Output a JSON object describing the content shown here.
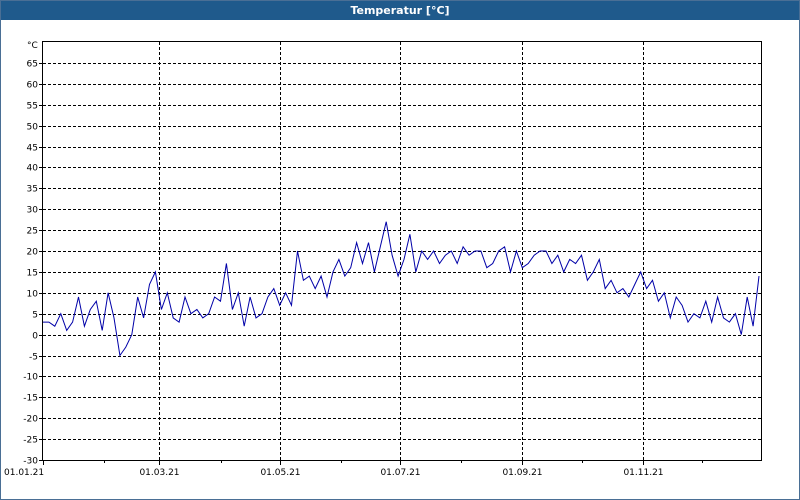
{
  "window": {
    "title": "Temperatur [°C]"
  },
  "colors": {
    "titlebar": "#1f5a8c",
    "series": "#0000a8",
    "grid": "#000000"
  },
  "chart_data": {
    "type": "line",
    "title": "Temperatur [°C]",
    "ylabel": "°C",
    "xlabel": "",
    "ylim": [
      -30,
      70
    ],
    "yticks": [
      -30,
      -25,
      -20,
      -15,
      -10,
      -5,
      0,
      5,
      10,
      15,
      20,
      25,
      30,
      35,
      40,
      45,
      50,
      55,
      60,
      65
    ],
    "xlim": [
      "2021-01-01",
      "2021-12-31"
    ],
    "xticks": [
      {
        "date": "2021-01-01",
        "label": "01.01.21"
      },
      {
        "date": "2021-03-01",
        "label": "01.03.21"
      },
      {
        "date": "2021-05-01",
        "label": "01.05.21"
      },
      {
        "date": "2021-07-01",
        "label": "01.07.21"
      },
      {
        "date": "2021-09-01",
        "label": "01.09.21"
      },
      {
        "date": "2021-11-01",
        "label": "01.11.21"
      }
    ],
    "grid": true,
    "series": [
      {
        "x": [
          "2021-01-01",
          "2021-01-04",
          "2021-01-07",
          "2021-01-10",
          "2021-01-13",
          "2021-01-16",
          "2021-01-19",
          "2021-01-22",
          "2021-01-25",
          "2021-01-28",
          "2021-01-31",
          "2021-02-03",
          "2021-02-06",
          "2021-02-09",
          "2021-02-12",
          "2021-02-15",
          "2021-02-18",
          "2021-02-21",
          "2021-02-24",
          "2021-02-27",
          "2021-03-02",
          "2021-03-05",
          "2021-03-08",
          "2021-03-11",
          "2021-03-14",
          "2021-03-17",
          "2021-03-20",
          "2021-03-23",
          "2021-03-26",
          "2021-03-29",
          "2021-04-01",
          "2021-04-04",
          "2021-04-07",
          "2021-04-10",
          "2021-04-13",
          "2021-04-16",
          "2021-04-19",
          "2021-04-22",
          "2021-04-25",
          "2021-04-28",
          "2021-05-01",
          "2021-05-04",
          "2021-05-07",
          "2021-05-10",
          "2021-05-13",
          "2021-05-16",
          "2021-05-19",
          "2021-05-22",
          "2021-05-25",
          "2021-05-28",
          "2021-05-31",
          "2021-06-03",
          "2021-06-06",
          "2021-06-09",
          "2021-06-12",
          "2021-06-15",
          "2021-06-18",
          "2021-06-21",
          "2021-06-24",
          "2021-06-27",
          "2021-06-30",
          "2021-07-03",
          "2021-07-06",
          "2021-07-09",
          "2021-07-12",
          "2021-07-15",
          "2021-07-18",
          "2021-07-21",
          "2021-07-24",
          "2021-07-27",
          "2021-07-30",
          "2021-08-02",
          "2021-08-05",
          "2021-08-08",
          "2021-08-11",
          "2021-08-14",
          "2021-08-17",
          "2021-08-20",
          "2021-08-23",
          "2021-08-26",
          "2021-08-29",
          "2021-09-01",
          "2021-09-04",
          "2021-09-07",
          "2021-09-10",
          "2021-09-13",
          "2021-09-16",
          "2021-09-19",
          "2021-09-22",
          "2021-09-25",
          "2021-09-28",
          "2021-10-01",
          "2021-10-04",
          "2021-10-07",
          "2021-10-10",
          "2021-10-13",
          "2021-10-16",
          "2021-10-19",
          "2021-10-22",
          "2021-10-25",
          "2021-10-28",
          "2021-10-31",
          "2021-11-03",
          "2021-11-06",
          "2021-11-09",
          "2021-11-12",
          "2021-11-15",
          "2021-11-18",
          "2021-11-21",
          "2021-11-24",
          "2021-11-27",
          "2021-11-30",
          "2021-12-03",
          "2021-12-06",
          "2021-12-09",
          "2021-12-12",
          "2021-12-15",
          "2021-12-18",
          "2021-12-21",
          "2021-12-24",
          "2021-12-27",
          "2021-12-30"
        ],
        "values": [
          3,
          3,
          2,
          5,
          1,
          3,
          9,
          2,
          6,
          8,
          1,
          10,
          4,
          -5,
          -3,
          0,
          9,
          4,
          12,
          15,
          6,
          10,
          4,
          3,
          9,
          5,
          6,
          4,
          5,
          9,
          8,
          17,
          6,
          10,
          2,
          9,
          4,
          5,
          9,
          11,
          7,
          10,
          7,
          20,
          13,
          14,
          11,
          14,
          9,
          15,
          18,
          14,
          16,
          22,
          17,
          22,
          15,
          21,
          27,
          19,
          14,
          18,
          24,
          15,
          20,
          18,
          20,
          17,
          19,
          20,
          17,
          21,
          19,
          20,
          20,
          16,
          17,
          20,
          21,
          15,
          20,
          16,
          17,
          19,
          20,
          20,
          17,
          19,
          15,
          18,
          17,
          19,
          13,
          15,
          18,
          11,
          13,
          10,
          11,
          9,
          12,
          15,
          11,
          13,
          8,
          10,
          4,
          9,
          7,
          3,
          5,
          4,
          8,
          3,
          9,
          4,
          3,
          5,
          0,
          9,
          2,
          14
        ]
      }
    ]
  }
}
